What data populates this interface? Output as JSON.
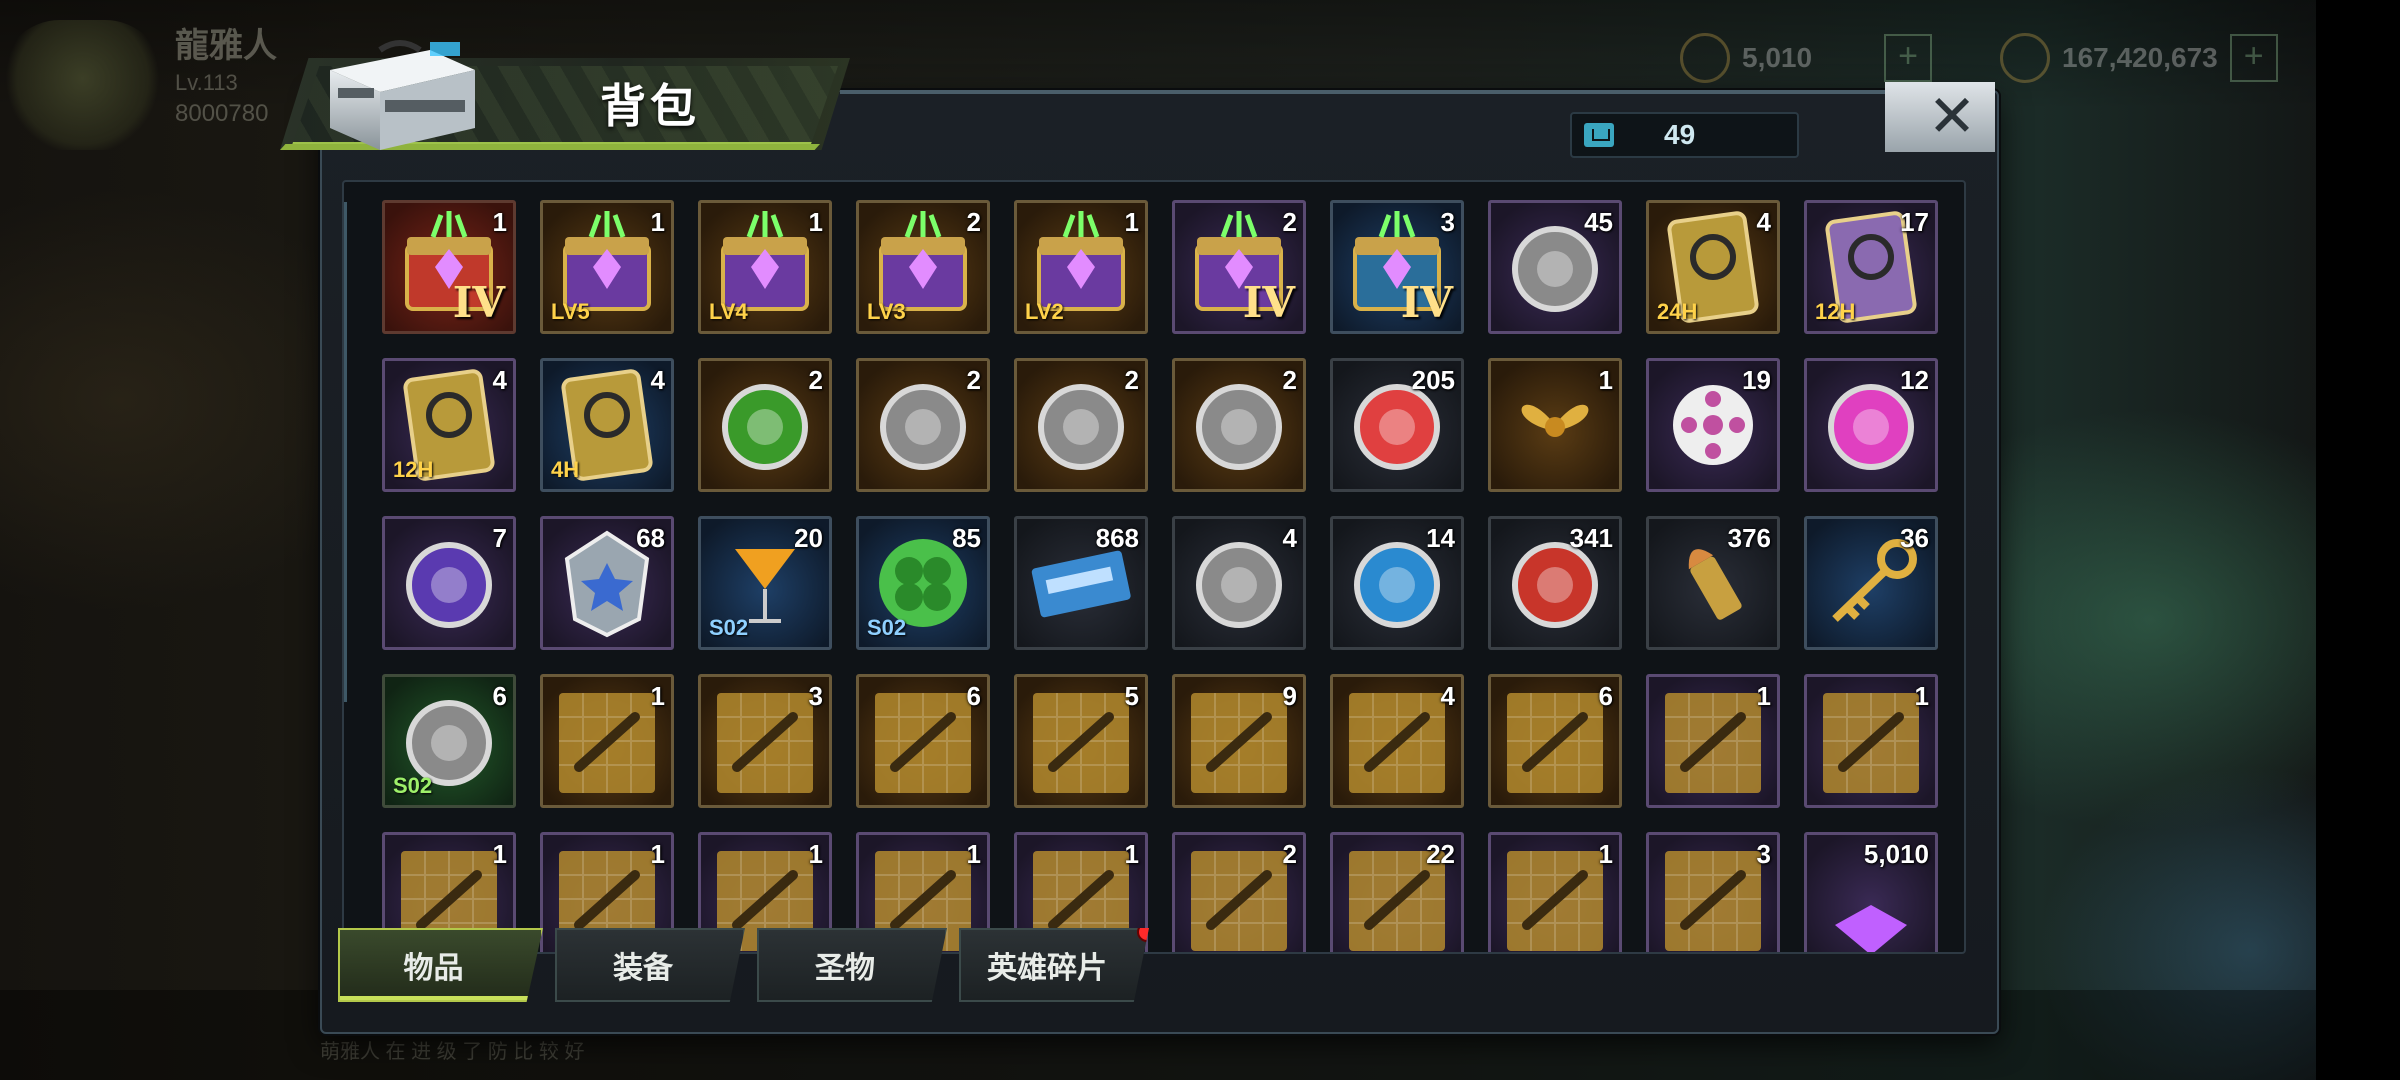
{
  "background": {
    "player_name": "龍雅人",
    "player_level": "Lv.113",
    "player_points": "8000780",
    "currency_1": "5,010",
    "currency_2": "167,420,673",
    "chat_text": "萌雅人 在 进 级 了 防 比 较 好"
  },
  "dialog": {
    "title": "背包",
    "capacity": "49",
    "close_label": "✕"
  },
  "items": [
    {
      "count": "1",
      "quality": "red",
      "icon": "sss-crate-icon",
      "tag": "IV",
      "tag_style": "big"
    },
    {
      "count": "1",
      "quality": "gold",
      "icon": "purple-crate-icon",
      "tag": "LV5",
      "tag_style": "gold"
    },
    {
      "count": "1",
      "quality": "gold",
      "icon": "purple-crate-icon",
      "tag": "LV4",
      "tag_style": "gold"
    },
    {
      "count": "2",
      "quality": "gold",
      "icon": "purple-crate-icon",
      "tag": "LV3",
      "tag_style": "gold"
    },
    {
      "count": "1",
      "quality": "gold",
      "icon": "purple-crate-icon",
      "tag": "LV2",
      "tag_style": "gold"
    },
    {
      "count": "2",
      "quality": "purple",
      "icon": "purple-supply-crate-icon",
      "tag": "IV",
      "tag_style": "big"
    },
    {
      "count": "3",
      "quality": "blue",
      "icon": "blue-supply-crate-icon",
      "tag": "IV",
      "tag_style": "big"
    },
    {
      "count": "45",
      "quality": "purple",
      "icon": "gear-refresh-icon",
      "tag": "",
      "tag_style": ""
    },
    {
      "count": "4",
      "quality": "gold",
      "icon": "gold-card-icon",
      "tag": "24H",
      "tag_style": "gold"
    },
    {
      "count": "17",
      "quality": "purple",
      "icon": "exp-card-icon",
      "tag": "12H",
      "tag_style": "gold"
    },
    {
      "count": "4",
      "quality": "purple",
      "icon": "gold-card-icon",
      "tag": "12H",
      "tag_style": "gold"
    },
    {
      "count": "4",
      "quality": "blue",
      "icon": "gold-card-icon",
      "tag": "4H",
      "tag_style": "gold"
    },
    {
      "count": "2",
      "quality": "gold",
      "icon": "green-leaf-medal-icon",
      "tag": "",
      "tag_style": ""
    },
    {
      "count": "2",
      "quality": "gold",
      "icon": "coin-medal-icon",
      "tag": "",
      "tag_style": ""
    },
    {
      "count": "2",
      "quality": "gold",
      "icon": "target-medal-icon",
      "tag": "",
      "tag_style": ""
    },
    {
      "count": "2",
      "quality": "gold",
      "icon": "radiation-medal-icon",
      "tag": "",
      "tag_style": ""
    },
    {
      "count": "205",
      "quality": "dark",
      "icon": "bottle-cap-icon",
      "tag": "",
      "tag_style": ""
    },
    {
      "count": "1",
      "quality": "gold",
      "icon": "gift-bow-icon",
      "tag": "",
      "tag_style": ""
    },
    {
      "count": "19",
      "quality": "purple",
      "icon": "film-reel-icon",
      "tag": "",
      "tag_style": ""
    },
    {
      "count": "12",
      "quality": "purple",
      "icon": "pink-cap-icon",
      "tag": "",
      "tag_style": ""
    },
    {
      "count": "7",
      "quality": "purple",
      "icon": "poker-chip-spade-icon",
      "tag": "",
      "tag_style": ""
    },
    {
      "count": "68",
      "quality": "purple",
      "icon": "police-badge-icon",
      "tag": "",
      "tag_style": ""
    },
    {
      "count": "20",
      "quality": "blue",
      "icon": "cocktail-icon",
      "tag": "S02",
      "tag_style": "blue"
    },
    {
      "count": "85",
      "quality": "blue",
      "icon": "clover-icon",
      "tag": "S02",
      "tag_style": "blue"
    },
    {
      "count": "868",
      "quality": "dark",
      "icon": "cinema-ticket-icon",
      "tag": "",
      "tag_style": ""
    },
    {
      "count": "4",
      "quality": "dark",
      "icon": "timer-token-icon",
      "tag": "",
      "tag_style": ""
    },
    {
      "count": "14",
      "quality": "dark",
      "icon": "b-cap-icon",
      "tag": "",
      "tag_style": ""
    },
    {
      "count": "341",
      "quality": "dark",
      "icon": "red-poker-chip-icon",
      "tag": "",
      "tag_style": ""
    },
    {
      "count": "376",
      "quality": "dark",
      "icon": "bullet-icon",
      "tag": "",
      "tag_style": ""
    },
    {
      "count": "36",
      "quality": "blue",
      "icon": "gold-key-icon",
      "tag": "",
      "tag_style": ""
    },
    {
      "count": "6",
      "quality": "green",
      "icon": "green-cap-hat-icon",
      "tag": "S02",
      "tag_style": "green"
    },
    {
      "count": "1",
      "quality": "gold",
      "icon": "dagger-blueprint-icon",
      "tag": "",
      "tag_style": ""
    },
    {
      "count": "3",
      "quality": "gold",
      "icon": "crossed-swords-blueprint-icon",
      "tag": "",
      "tag_style": ""
    },
    {
      "count": "6",
      "quality": "gold",
      "icon": "cowboy-hat-blueprint-icon",
      "tag": "",
      "tag_style": ""
    },
    {
      "count": "5",
      "quality": "gold",
      "icon": "glasses-blueprint-icon",
      "tag": "",
      "tag_style": ""
    },
    {
      "count": "9",
      "quality": "gold",
      "icon": "boot-blueprint-icon",
      "tag": "",
      "tag_style": ""
    },
    {
      "count": "4",
      "quality": "gold",
      "icon": "revolver-blueprint-icon",
      "tag": "",
      "tag_style": ""
    },
    {
      "count": "6",
      "quality": "gold",
      "icon": "shirt-blueprint-icon",
      "tag": "",
      "tag_style": ""
    },
    {
      "count": "1",
      "quality": "purple",
      "icon": "boot-blueprint-icon",
      "tag": "",
      "tag_style": ""
    },
    {
      "count": "1",
      "quality": "purple",
      "icon": "glasses-blueprint-icon",
      "tag": "",
      "tag_style": ""
    },
    {
      "count": "1",
      "quality": "purple",
      "icon": "shirt-blueprint-icon",
      "tag": "",
      "tag_style": ""
    },
    {
      "count": "1",
      "quality": "purple",
      "icon": "shirt-blueprint-icon",
      "tag": "",
      "tag_style": ""
    },
    {
      "count": "1",
      "quality": "purple",
      "icon": "dagger-blueprint-icon",
      "tag": "",
      "tag_style": ""
    },
    {
      "count": "1",
      "quality": "purple",
      "icon": "shirt-blueprint-icon",
      "tag": "",
      "tag_style": ""
    },
    {
      "count": "1",
      "quality": "purple",
      "icon": "glasses-blueprint-icon",
      "tag": "",
      "tag_style": ""
    },
    {
      "count": "2",
      "quality": "purple",
      "icon": "glasses-blueprint-icon",
      "tag": "",
      "tag_style": ""
    },
    {
      "count": "22",
      "quality": "purple",
      "icon": "shirt-blueprint-icon",
      "tag": "",
      "tag_style": ""
    },
    {
      "count": "1",
      "quality": "purple",
      "icon": "shirt-blueprint-icon",
      "tag": "",
      "tag_style": ""
    },
    {
      "count": "3",
      "quality": "purple",
      "icon": "glasses-blueprint-icon",
      "tag": "",
      "tag_style": ""
    },
    {
      "count": "5,010",
      "quality": "purple",
      "icon": "purple-gem-icon",
      "tag": "",
      "tag_style": ""
    }
  ],
  "tabs": [
    {
      "label": "物品",
      "active": true,
      "badge": false
    },
    {
      "label": "装备",
      "active": false,
      "badge": false
    },
    {
      "label": "圣物",
      "active": false,
      "badge": false
    },
    {
      "label": "英雄碎片",
      "active": false,
      "badge": true
    }
  ],
  "colors": {
    "accent": "#b3c84a",
    "badge": "#ff2a2a",
    "capacity_icon": "#3aa6c0"
  }
}
